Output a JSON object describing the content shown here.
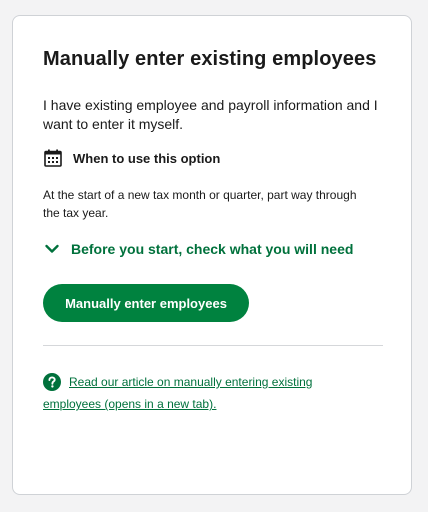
{
  "card": {
    "title": "Manually enter existing employees",
    "intro": "I have existing employee and payroll information and I want to enter it myself.",
    "when_label": "When to use this option",
    "when_text": "At the start of a new tax month or quarter, part way through the tax year.",
    "expander_label": "Before you start, check what you will need",
    "expander_icon": "chevron-down-icon",
    "primary_button": "Manually enter employees",
    "help_link": "Read our article on manually entering existing employees (opens in a new tab).",
    "help_icon": "question-circle-icon",
    "calendar_icon": "calendar-icon"
  },
  "colors": {
    "brand_green": "#00823f",
    "link_green": "#00713c",
    "text": "#1a1a1a",
    "background": "#f3f3f4",
    "card_border": "#cfd2d6"
  }
}
